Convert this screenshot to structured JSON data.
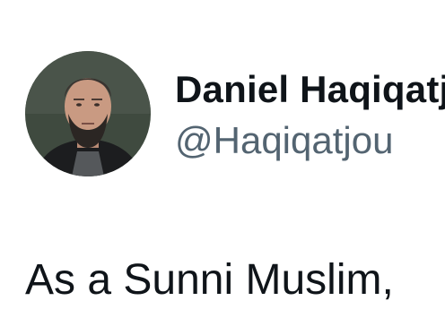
{
  "author": {
    "display_name": "Daniel Haqiqatjou",
    "handle": "@Haqiqatjou",
    "avatar_icon": "profile-photo"
  },
  "tweet": {
    "text": "As a Sunni Muslim,"
  },
  "colors": {
    "name": "#0f1419",
    "handle": "#536471",
    "background": "#ffffff"
  }
}
